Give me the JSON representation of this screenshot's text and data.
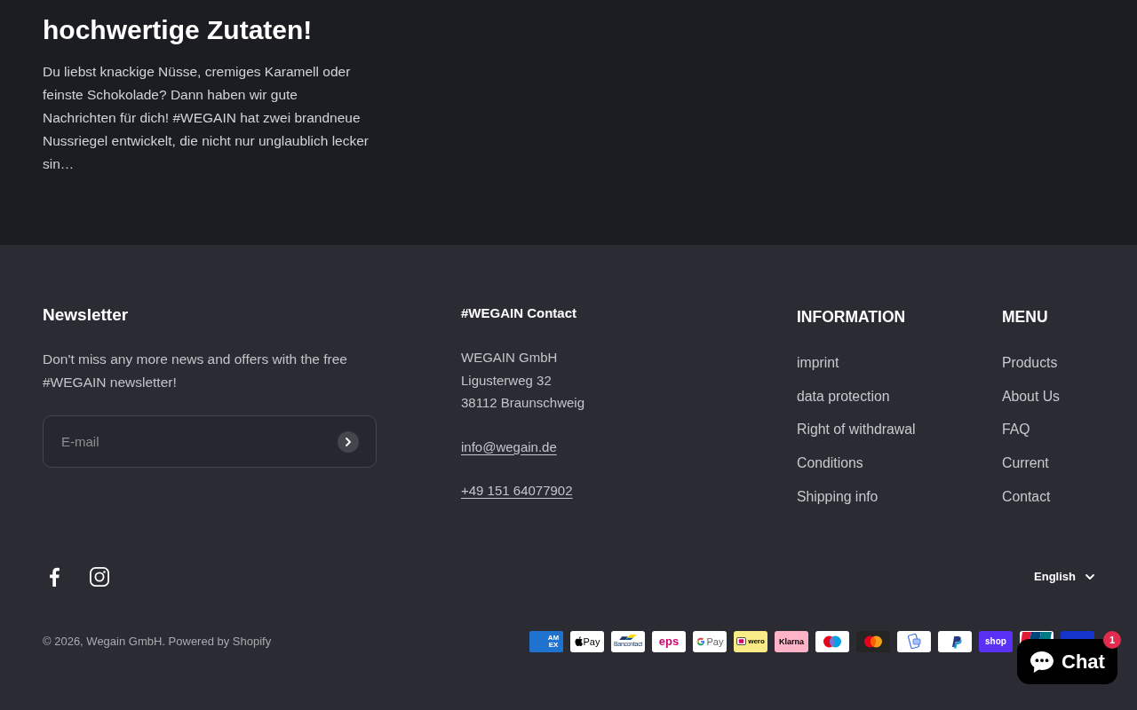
{
  "article": {
    "title": "hochwertige Zutaten!",
    "excerpt": "Du liebst knackige Nüsse, cremiges Karamell oder feinste Schokolade? Dann haben wir gute Nachrichten für dich! #WEGAIN hat zwei brandneue Nussriegel entwickelt, die nicht nur unglaublich lecker sin…"
  },
  "footer": {
    "newsletter": {
      "title": "Newsletter",
      "text": "Don't miss any more news and offers with the free #WEGAIN newsletter!",
      "email": {
        "placeholder": "E-mail"
      }
    },
    "contact": {
      "title": "#WEGAIN Contact",
      "address": [
        "WEGAIN GmbH",
        "Ligusterweg 32",
        "38112 Braunschweig"
      ],
      "email": "info@wegain.de",
      "phone": "+49 151 64077902"
    },
    "columns": [
      {
        "title": "INFORMATION",
        "links": [
          "imprint",
          "data protection",
          "Right of withdrawal",
          "Conditions",
          "Shipping info"
        ]
      },
      {
        "title": "MENU",
        "links": [
          "Products",
          "About Us",
          "FAQ",
          "Current",
          "Contact"
        ]
      }
    ],
    "social": [
      {
        "kind": "facebook"
      },
      {
        "kind": "instagram"
      }
    ],
    "language": {
      "value": "English"
    },
    "copyright": {
      "prefix": "© 2026,",
      "company": "Wegain GmbH",
      "separator": ".",
      "powered": "Powered by Shopify"
    },
    "payments": [
      {
        "kind": "amex",
        "label": "AM EX"
      },
      {
        "kind": "apple_pay",
        "label": "Pay"
      },
      {
        "kind": "bancontact",
        "label": "Bancontact"
      },
      {
        "kind": "eps",
        "label": "eps"
      },
      {
        "kind": "google_pay",
        "label": "Pay"
      },
      {
        "kind": "wero",
        "label": "wero"
      },
      {
        "kind": "klarna",
        "label": "Klarna"
      },
      {
        "kind": "maestro"
      },
      {
        "kind": "mastercard"
      },
      {
        "kind": "generic"
      },
      {
        "kind": "paypal"
      },
      {
        "kind": "shop_pay",
        "label": "shop"
      },
      {
        "kind": "unionpay"
      },
      {
        "kind": "visa"
      }
    ]
  },
  "chat": {
    "label": "Chat",
    "badge": "1"
  }
}
